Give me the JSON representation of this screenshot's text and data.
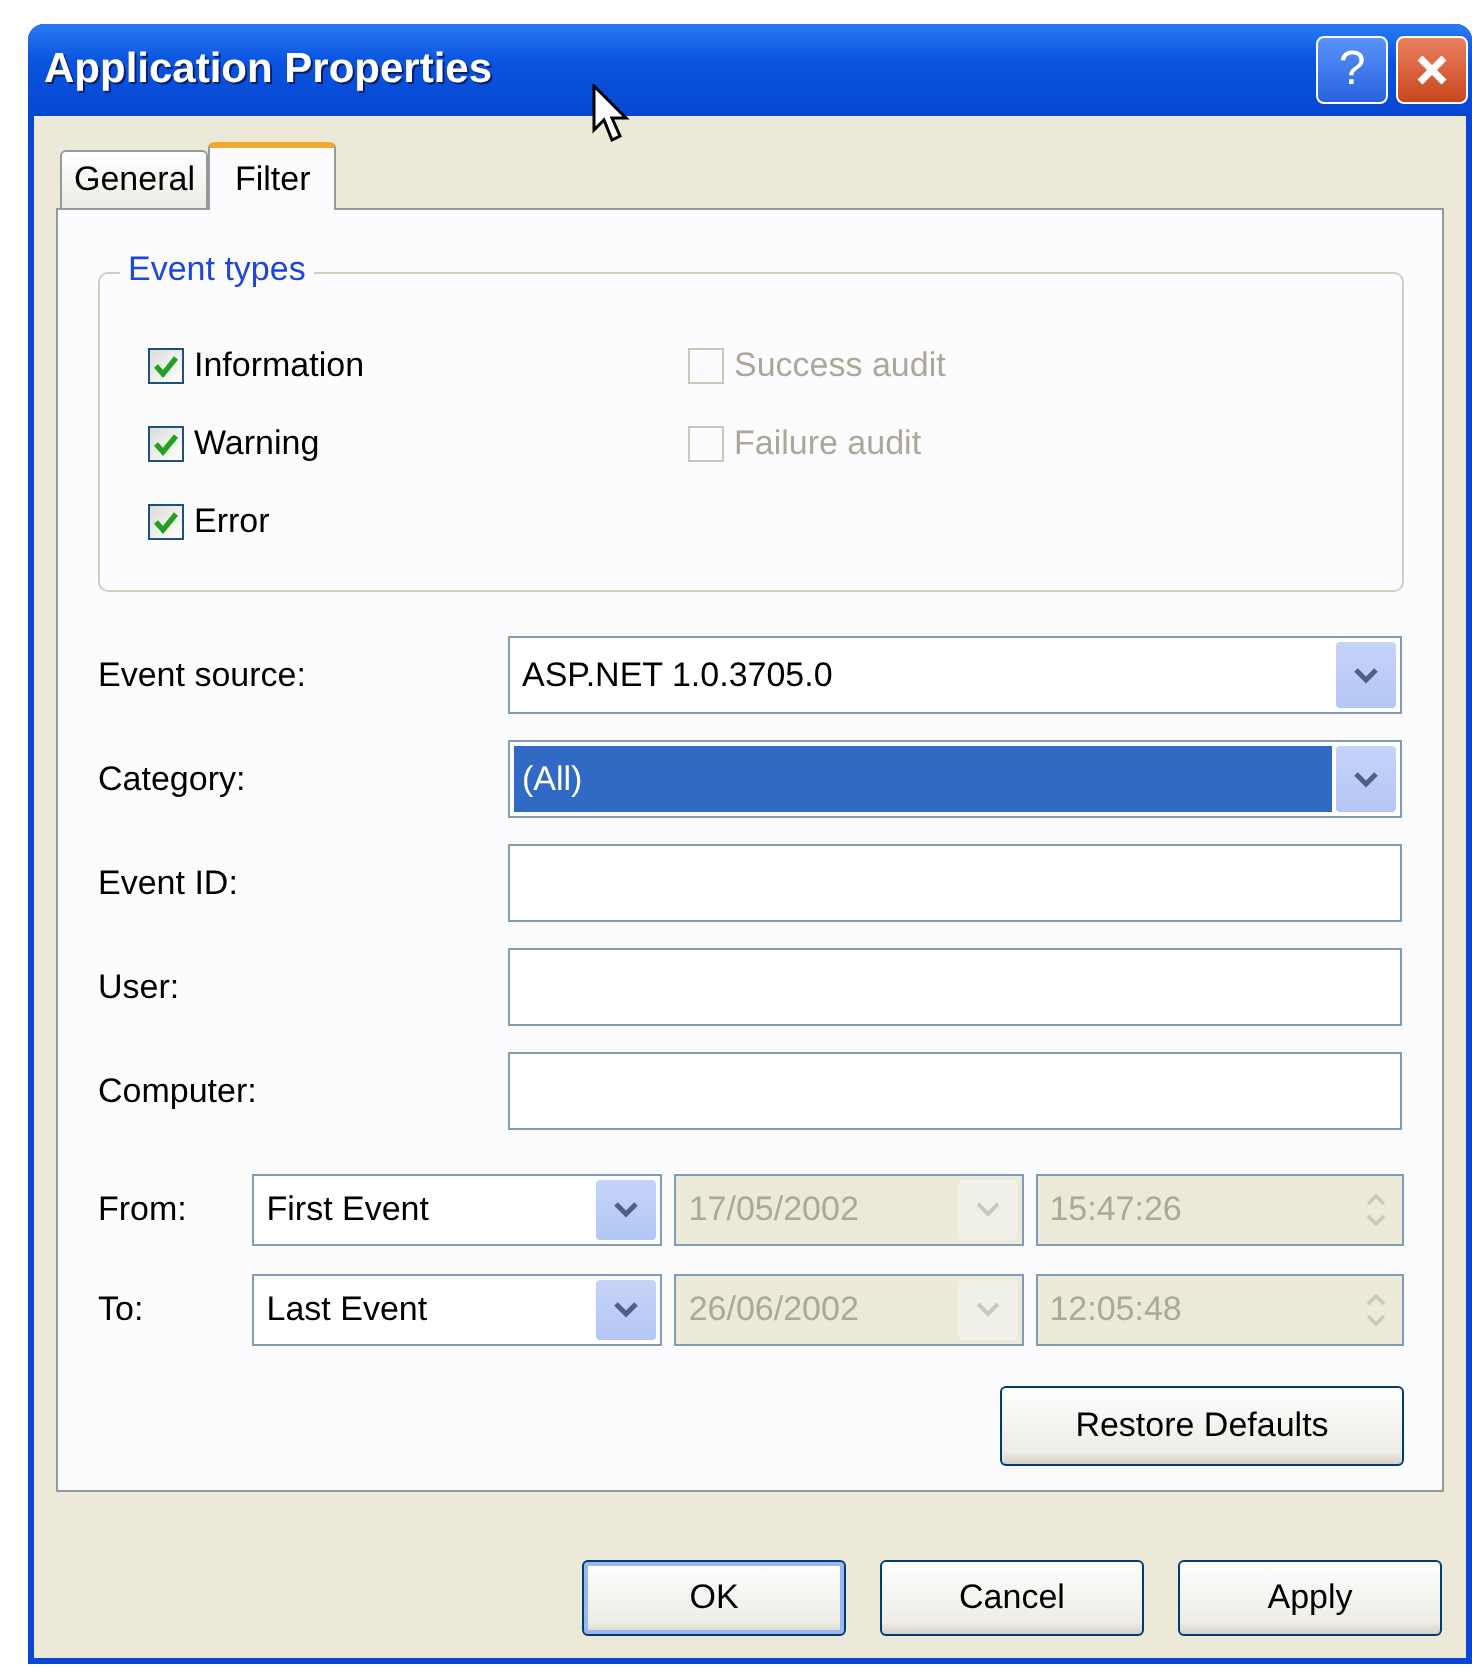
{
  "window": {
    "title": "Application Properties",
    "help_button": "?"
  },
  "tabs": [
    {
      "label": "General",
      "selected": false
    },
    {
      "label": "Filter",
      "selected": true
    }
  ],
  "event_types": {
    "title": "Event types",
    "options": [
      {
        "label": "Information",
        "checked": true,
        "disabled": false
      },
      {
        "label": "Warning",
        "checked": true,
        "disabled": false
      },
      {
        "label": "Error",
        "checked": true,
        "disabled": false
      },
      {
        "label": "Success audit",
        "checked": false,
        "disabled": true
      },
      {
        "label": "Failure audit",
        "checked": false,
        "disabled": true
      }
    ]
  },
  "fields": [
    {
      "label": "Event source:",
      "kind": "dropdown",
      "value": "ASP.NET 1.0.3705.0",
      "selected": false
    },
    {
      "label": "Category:",
      "kind": "dropdown",
      "value": "(All)",
      "selected": true
    },
    {
      "label": "Event ID:",
      "kind": "text"
    },
    {
      "label": "User:",
      "kind": "text"
    },
    {
      "label": "Computer:",
      "kind": "text"
    }
  ],
  "range": [
    {
      "label": "From:",
      "mode": "First Event",
      "date": "17/05/2002",
      "time": "15:47:26",
      "disabled": true
    },
    {
      "label": "To:",
      "mode": "Last Event",
      "date": "26/06/2002",
      "time": "12:05:48",
      "disabled": true
    }
  ],
  "restore_button": "Restore Defaults",
  "buttons": [
    {
      "label": "OK",
      "default": true
    },
    {
      "label": "Cancel",
      "default": false
    },
    {
      "label": "Apply",
      "default": false
    }
  ]
}
